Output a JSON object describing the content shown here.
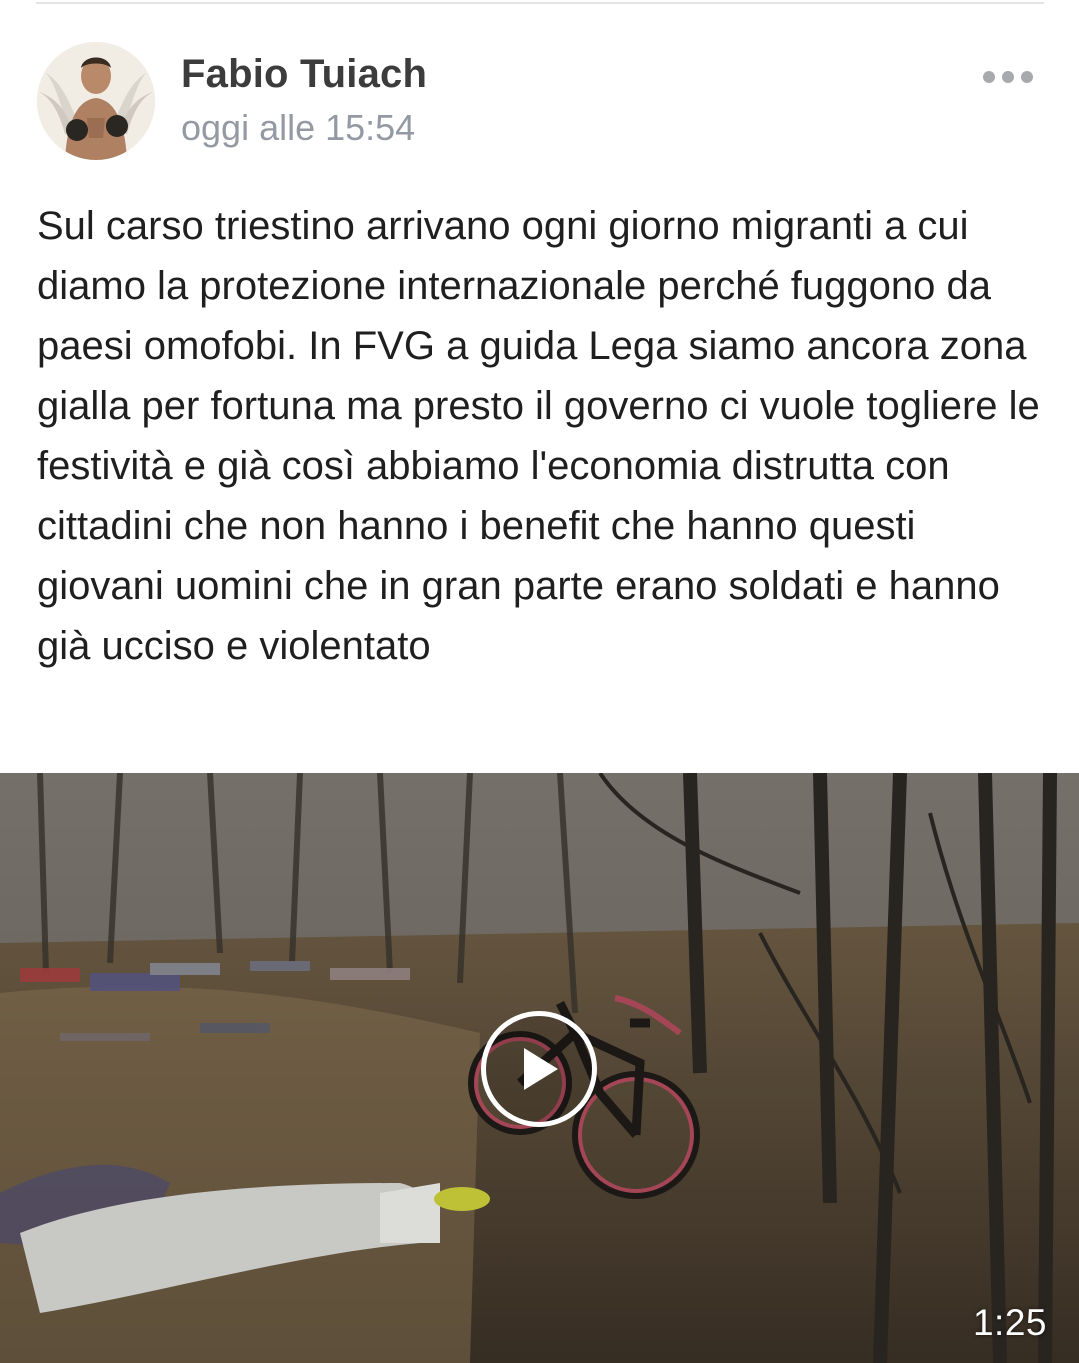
{
  "post": {
    "author": "Fabio Tuiach",
    "timestamp": "oggi alle 15:54",
    "more_icon": "more-horizontal-icon",
    "text": "Sul carso triestino arrivano ogni giorno migranti a cui diamo la protezione internazionale perché fuggono da paesi omofobi. In FVG a guida Lega siamo ancora zona gialla per fortuna ma presto il governo ci vuole togliere le festività e già così abbiamo l'economia distrutta con cittadini che non hanno i benefit che hanno questi giovani uomini che in gran parte erano soldati e hanno già ucciso e violentato"
  },
  "video": {
    "duration": "1:25",
    "play_icon": "play-icon"
  },
  "colors": {
    "author": "#3c3c3c",
    "timestamp": "#939aa3",
    "body_text": "#1f1f1f",
    "more_dots": "#a7a9ad"
  }
}
